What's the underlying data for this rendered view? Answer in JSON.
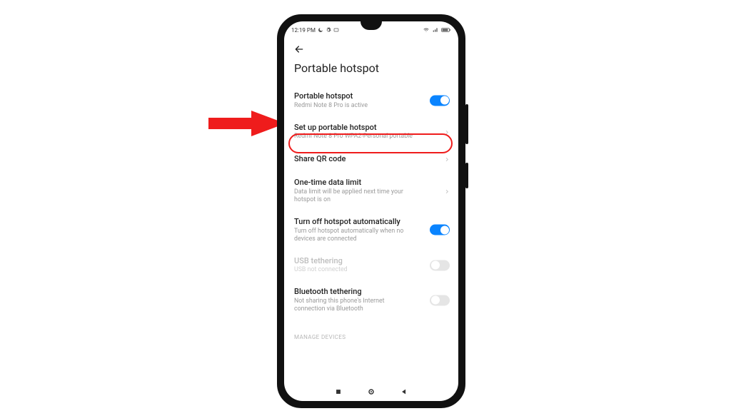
{
  "status": {
    "time": "12:19 PM",
    "icons_left": [
      "moon-icon",
      "gear-icon",
      "card-icon"
    ],
    "icons_right": [
      "wifi-icon",
      "signal-icon",
      "battery-icon"
    ]
  },
  "header": {
    "title": "Portable hotspot"
  },
  "rows": {
    "hotspot": {
      "title": "Portable hotspot",
      "sub": "Redmi Note 8 Pro is active",
      "on": true
    },
    "setup": {
      "title": "Set up portable hotspot",
      "sub": "Redmi Note 8 Pro WPA2-Personal portable"
    },
    "qr": {
      "title": "Share QR code"
    },
    "limit": {
      "title": "One-time data limit",
      "sub": "Data limit will be applied next time your hotspot is on"
    },
    "autooff": {
      "title": "Turn off hotspot automatically",
      "sub": "Turn off hotspot automatically when no devices are connected",
      "on": true
    },
    "usb": {
      "title": "USB tethering",
      "sub": "USB not connected",
      "on": false
    },
    "bt": {
      "title": "Bluetooth tethering",
      "sub": "Not sharing this phone's Internet connection via Bluetooth",
      "on": false
    }
  },
  "section": {
    "manage": "MANAGE DEVICES"
  },
  "annotation": {
    "target": "setup"
  }
}
